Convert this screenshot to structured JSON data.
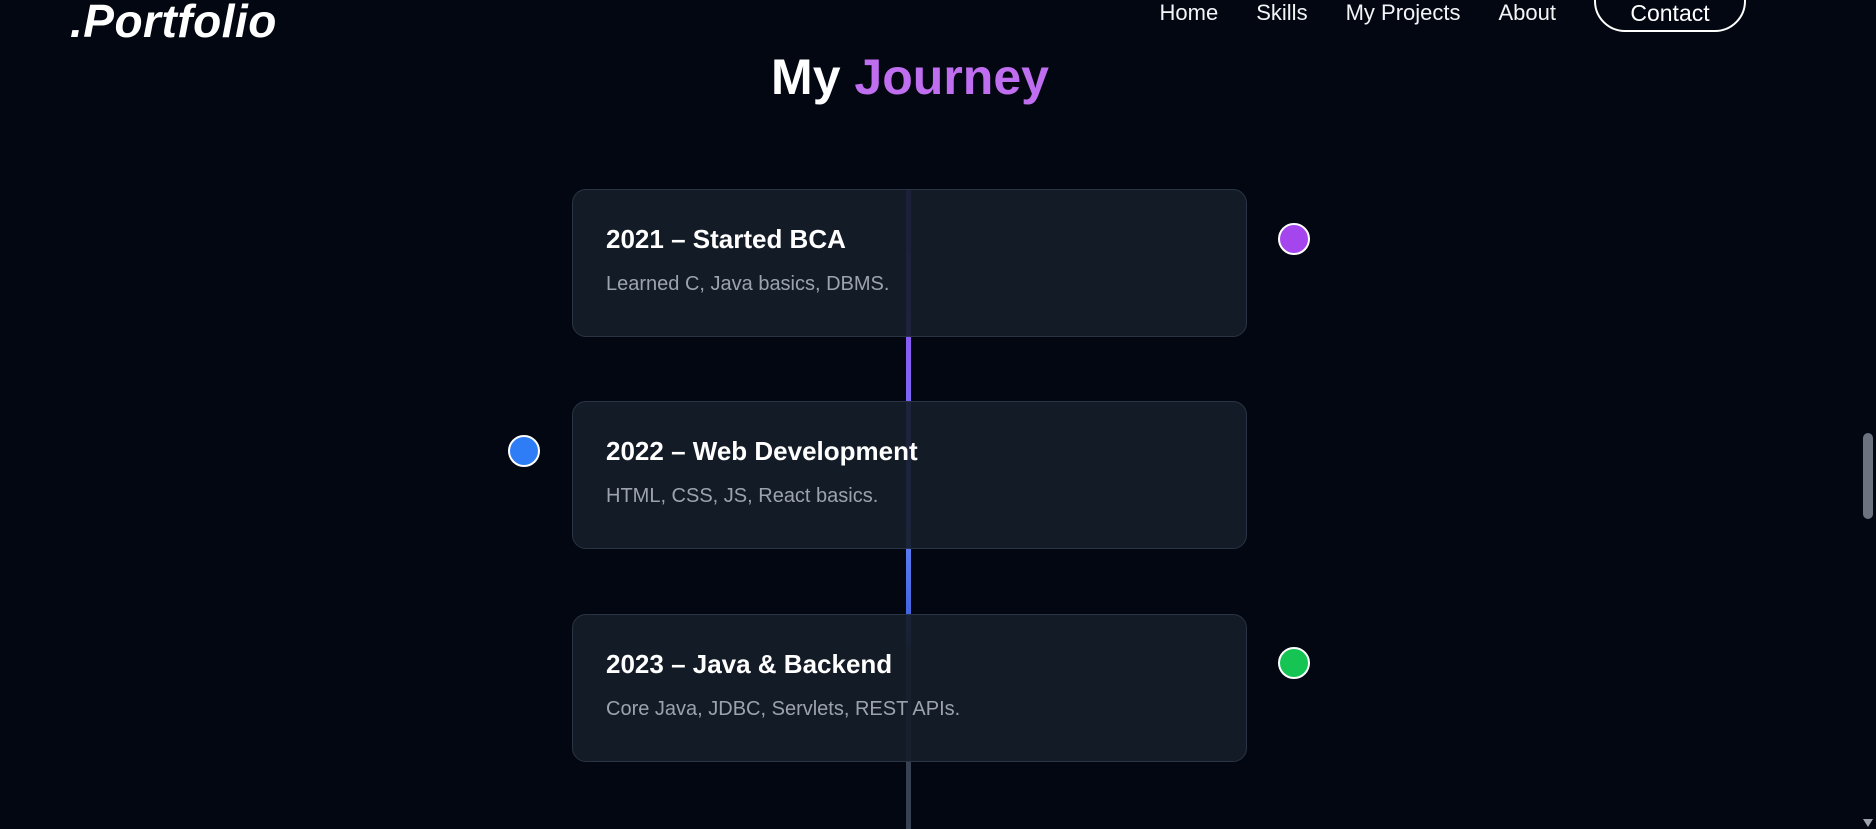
{
  "nav": {
    "logo": ".Portfolio",
    "links": [
      "Home",
      "Skills",
      "My Projects",
      "About"
    ],
    "contact": "Contact"
  },
  "section": {
    "title_part1": "My",
    "title_part2": "Journey"
  },
  "timeline": [
    {
      "title": "2021 – Started BCA",
      "desc": "Learned C, Java basics, DBMS.",
      "dot_color": "#a545ee",
      "dot_side": "right"
    },
    {
      "title": "2022 – Web Development",
      "desc": "HTML, CSS, JS, React basics.",
      "dot_color": "#2e7cf6",
      "dot_side": "left"
    },
    {
      "title": "2023 – Java & Backend",
      "desc": "Core Java, JDBC, Servlets, REST APIs.",
      "dot_color": "#16c453",
      "dot_side": "right"
    }
  ],
  "colors": {
    "background": "#030712",
    "accent": "#c06ef0",
    "card": "#151d29"
  }
}
